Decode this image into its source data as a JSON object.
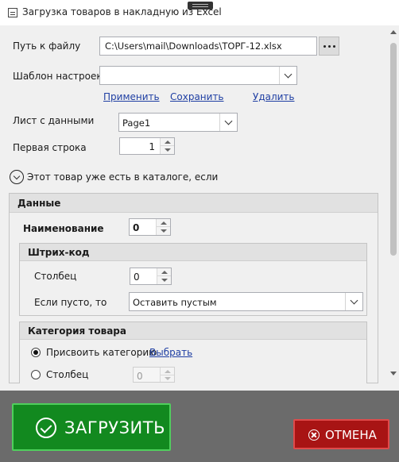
{
  "window": {
    "title": "Загрузка товаров в накладную из Excel"
  },
  "file": {
    "label": "Путь к файлу",
    "value": "C:\\Users\\mail\\Downloads\\ТОРГ-12.xlsx"
  },
  "template": {
    "label": "Шаблон настроек",
    "value": "",
    "apply_link": "Применить",
    "save_link": "Сохранить",
    "delete_link": "Удалить"
  },
  "sheet": {
    "label": "Лист с данными",
    "value": "Page1"
  },
  "first_row": {
    "label": "Первая строка",
    "value": "1"
  },
  "expander": {
    "label": "Этот товар уже есть в каталоге, если"
  },
  "data_section": {
    "header": "Данные",
    "name": {
      "label": "Наименование",
      "value": "0"
    },
    "barcode": {
      "header": "Штрих-код",
      "column_label": "Столбец",
      "column_value": "0",
      "if_empty_label": "Если пусто, то",
      "if_empty_value": "Оставить пустым"
    },
    "category": {
      "header": "Категория товара",
      "assign_label": "Присвоить категорию",
      "choose_link": "Выбрать",
      "column_label": "Столбец",
      "column_value": "0"
    }
  },
  "footer": {
    "load_label": "ЗАГРУЗИТЬ",
    "cancel_label": "ОТМЕНА"
  },
  "colors": {
    "load": "#12891f",
    "cancel": "#a81414",
    "link": "#1f3fa3"
  }
}
